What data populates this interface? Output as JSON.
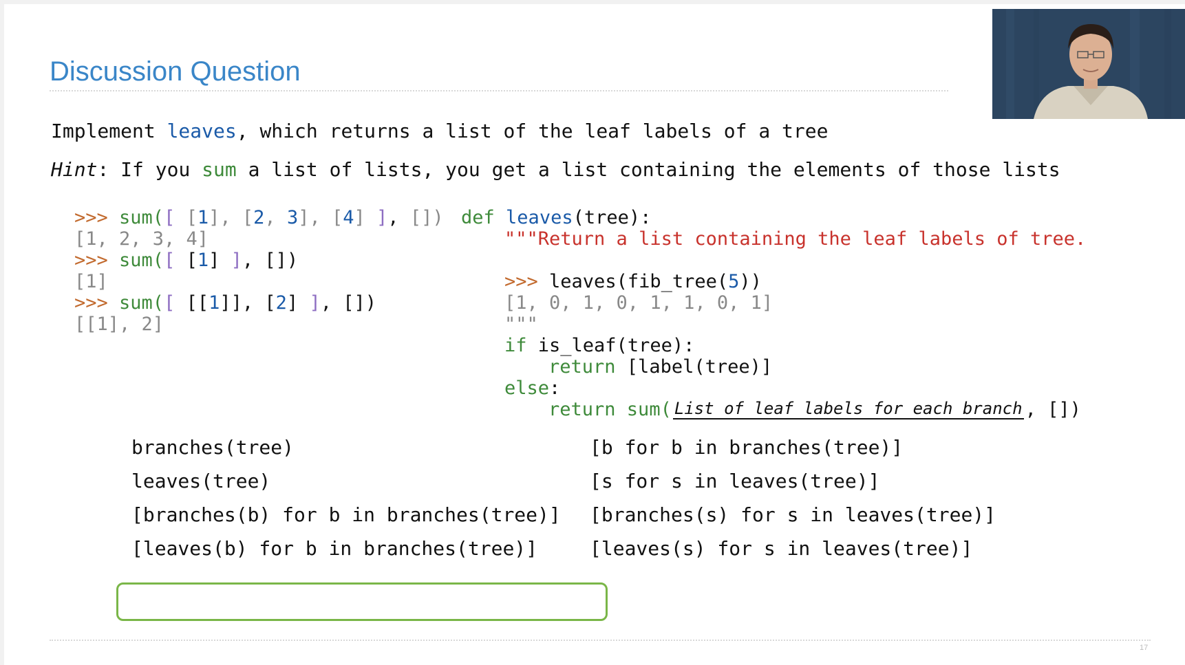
{
  "slide": {
    "title": "Discussion Question",
    "page_number": "17"
  },
  "prompt": {
    "line1_pre": "Implement ",
    "line1_fn": "leaves",
    "line1_post": ", which returns a list of the leaf labels of a tree",
    "hint_label": "Hint",
    "hint_pre": ": If you ",
    "hint_fn": "sum",
    "hint_post": " a list of lists, you get a list containing the elements of those lists"
  },
  "examples": {
    "prompt": ">>>",
    "call1": {
      "a": " sum(",
      "b": "[ ",
      "c": "[",
      "d": "1",
      "e": "], ",
      "f": "[",
      "g": "2",
      "h": ", ",
      "i": "3",
      "j": "], ",
      "k": "[",
      "l": "4",
      "m": "] ",
      "n": "]",
      "o": ", ",
      "p": "[]",
      "q": ")"
    },
    "out1": "[1, 2, 3, 4]",
    "call2": {
      "a": " sum(",
      "b": "[ ",
      "c": "[",
      "d": "1",
      "e": "] ",
      "f": "]",
      "g": ", ",
      "h": "[]",
      "i": ")"
    },
    "out2": "[1]",
    "call3": {
      "a": " sum(",
      "b": "[ ",
      "c": "[[",
      "d": "1",
      "e": "]], ",
      "f": "[",
      "g": "2",
      "h": "] ",
      "i": "]",
      "j": ", ",
      "k": "[]",
      "l": ")"
    },
    "out3": "[[1], 2]"
  },
  "function": {
    "def_kw": "def",
    "name": "leaves",
    "sig_rest": "(tree):",
    "docstring_open": "\"\"\"Return a list containing the leaf labels of tree.",
    "doctest_prompt": ">>>",
    "doctest_call_pre": " leaves(fib_tree(",
    "doctest_call_num": "5",
    "doctest_call_post": "))",
    "doctest_output": "[1, 0, 1, 0, 1, 1, 0, 1]",
    "docstring_close": "\"\"\"",
    "if_kw": "if",
    "if_rest": " is_leaf(tree):",
    "return_kw": "return",
    "return1_rest": " [label(tree)]",
    "else_kw": "else",
    "else_colon": ":",
    "return2_pre": " sum(",
    "blank_text": "List of leaf labels for each branch",
    "return2_post": ", [])"
  },
  "choices": {
    "left": [
      "branches(tree)",
      "leaves(tree)",
      "[branches(b) for b in branches(tree)]",
      "[leaves(b) for b in branches(tree)]"
    ],
    "right": [
      "[b for b in branches(tree)]",
      "[s for s in leaves(tree)]",
      "[branches(s) for s in leaves(tree)]",
      "[leaves(s) for s in leaves(tree)]"
    ],
    "selected_index": 3,
    "selected_color": "#7ab648"
  },
  "colors": {
    "title": "#3a86c8",
    "prompt": "#c26a2e",
    "keyword": "#3e8a3a",
    "function_name": "#1a5aa8",
    "docstring": "#c8322c"
  }
}
